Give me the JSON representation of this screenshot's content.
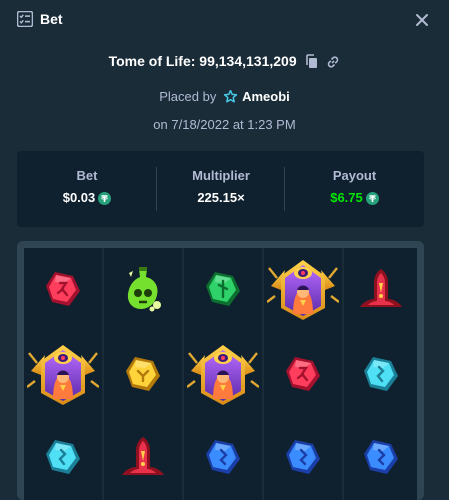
{
  "header": {
    "title": "Bet",
    "icon": "bet-list-icon",
    "close_icon": "close-icon"
  },
  "game": {
    "name_value": "Tome of Life: 99,134,131,209",
    "copy_icon": "copy-icon",
    "link_icon": "link-icon"
  },
  "placed": {
    "prefix": "Placed by",
    "username": "Ameobi",
    "user_icon": "star-badge-icon"
  },
  "date": "on 7/18/2022 at 1:23 PM",
  "stats": {
    "bet_label": "Bet",
    "bet_value": "$0.03",
    "multiplier_label": "Multiplier",
    "multiplier_value": "225.15×",
    "payout_label": "Payout",
    "payout_value": "$6.75",
    "currency_icon": "tether-coin-icon"
  },
  "colors": {
    "background": "#1a2c38",
    "panel": "#0f212e",
    "label": "#b1bad3",
    "payout": "#00e701",
    "tether": "#26a17b",
    "board_border": "#2f4553"
  },
  "board": {
    "columns": [
      [
        "red-rune-gem",
        "purple-eye-totem",
        "cyan-rune-gem"
      ],
      [
        "green-potion-skull",
        "yellow-rune-gem",
        "red-rune-shrine"
      ],
      [
        "green-rune-gem",
        "purple-eye-totem",
        "blue-rune-gem"
      ],
      [
        "purple-eye-totem",
        "red-rune-gem",
        "blue-rune-gem"
      ],
      [
        "red-rune-shrine",
        "cyan-rune-gem",
        "blue-rune-gem"
      ]
    ]
  }
}
